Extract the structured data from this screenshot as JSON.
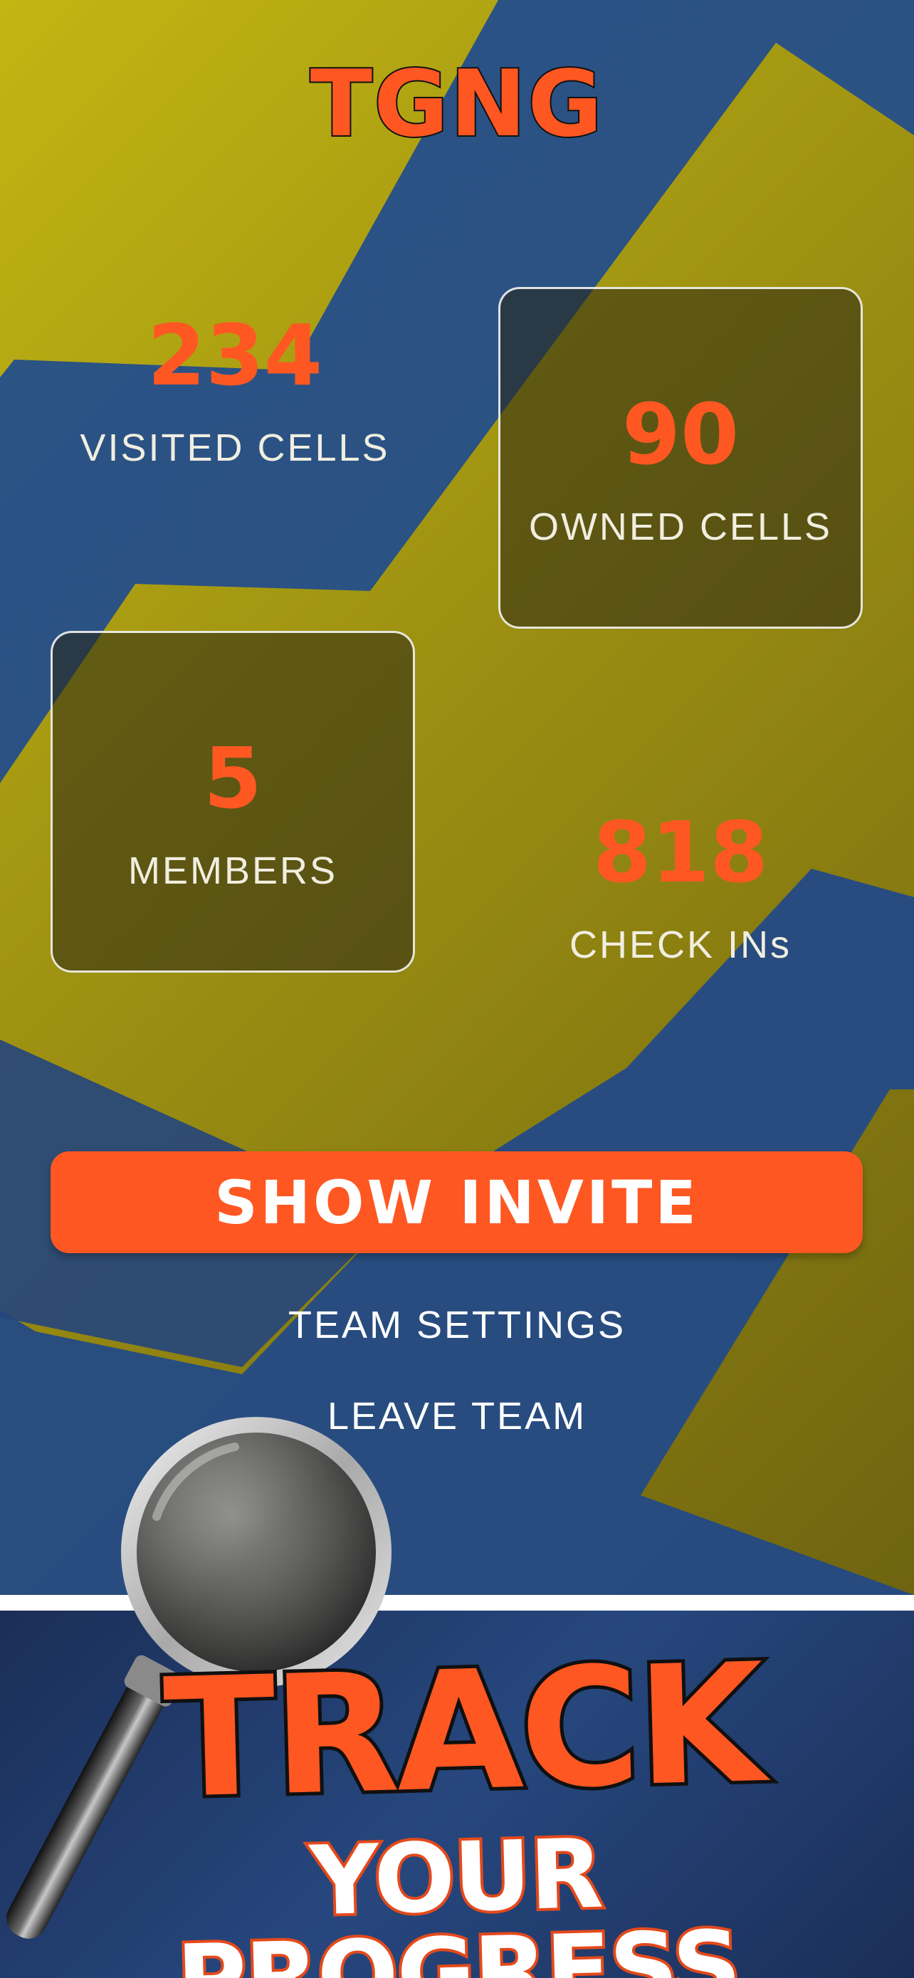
{
  "team": {
    "name": "TGNG"
  },
  "stats": {
    "visited": {
      "value": "234",
      "label": "VISITED CELLS"
    },
    "owned": {
      "value": "90",
      "label": "OWNED CELLS"
    },
    "members": {
      "value": "5",
      "label": "MEMBERS"
    },
    "checkins": {
      "value": "818",
      "label": "CHECK INs"
    }
  },
  "actions": {
    "show_invite": "SHOW  INVITE",
    "team_settings": "TEAM SETTINGS",
    "leave_team": "LEAVE TEAM"
  },
  "promo": {
    "title": "TRACK",
    "subtitle": "YOUR PROGRESS"
  },
  "colors": {
    "accent": "#ff5722",
    "yellow": "#c2b613",
    "blue": "#244e8a",
    "card_bg": "rgba(40,38,20,0.55)"
  },
  "icons": {
    "magnifier": "magnifying-glass-icon"
  }
}
